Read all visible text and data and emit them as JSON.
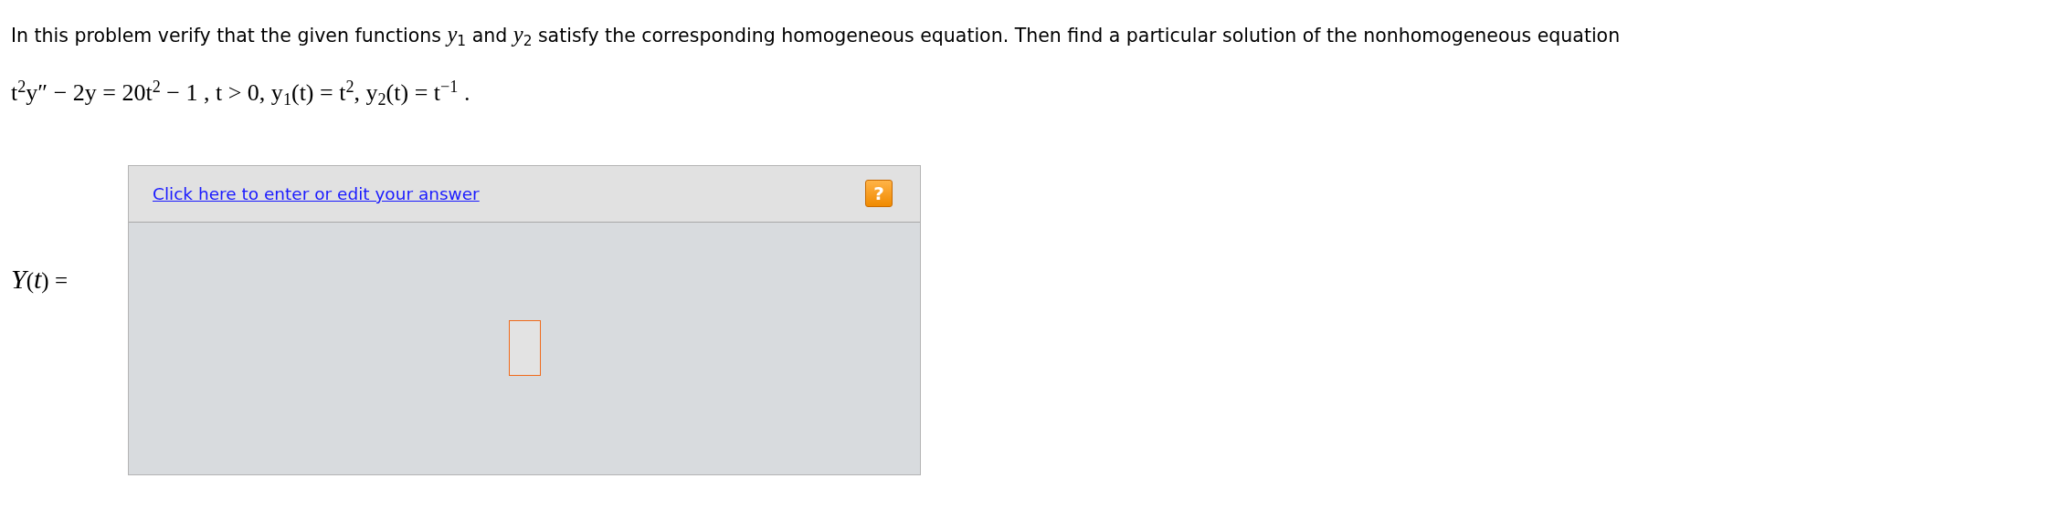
{
  "problem": {
    "statement": "In this problem verify that the given functions *y*$_{1}$ and *y*$_{2}$ satisfy the corresponding homogeneous equation. Then find a particular solution of the nonhomogeneous equation",
    "equation": "t$^{2}$y″ − 2y = 20t$^{2}$ − 1 , t > 0, y$_{1}$(t) = t$^{2}$, y$_{2}$(t) = t$^{−1}$ ."
  },
  "answer": {
    "label": "*Y*(*t*) =",
    "link": "Click here to enter or edit your answer",
    "help_button": "?"
  }
}
